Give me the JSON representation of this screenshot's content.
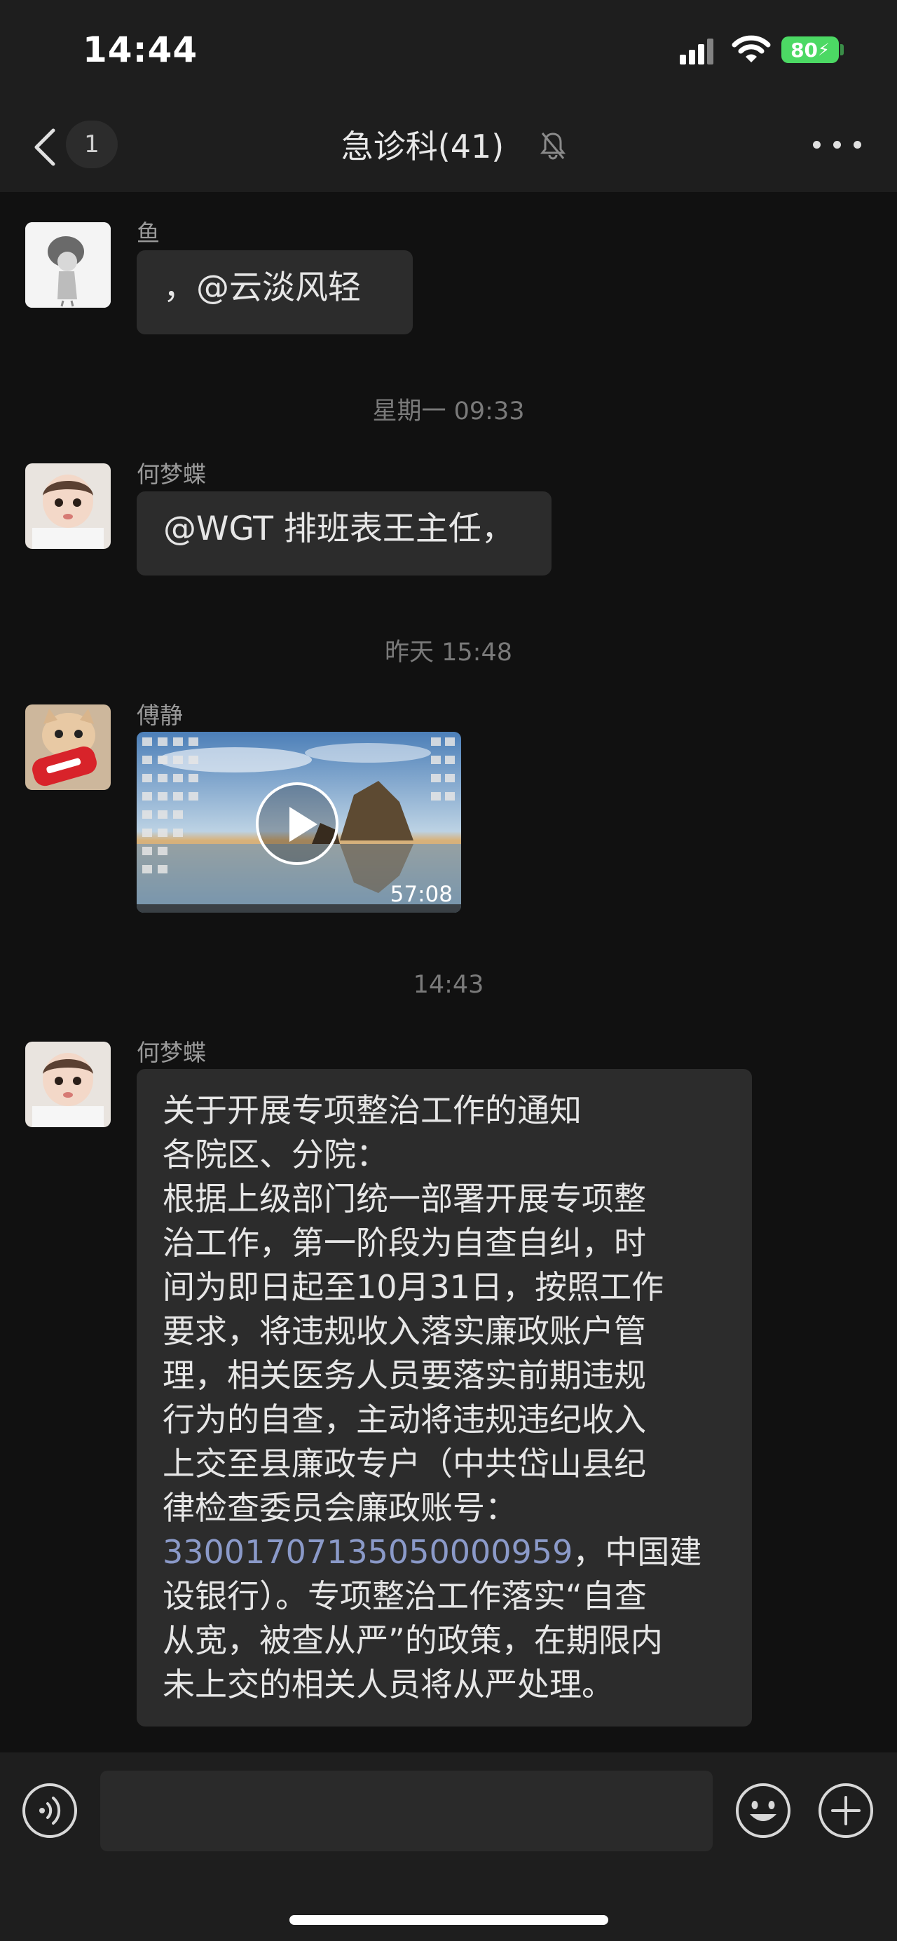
{
  "status_bar": {
    "time": "14:44",
    "battery": "80",
    "signal-icon": "cellular-signal-icon",
    "wifi-icon": "wifi-icon"
  },
  "header": {
    "back_icon": "chevron-left-icon",
    "unread_count": "1",
    "title": "急诊科(41)",
    "mute_icon": "bell-slash-icon",
    "more_icon": "ellipsis-icon"
  },
  "messages": [
    {
      "sender": "鱼",
      "text": "，@云淡风轻"
    },
    {
      "sender": "何梦蝶",
      "text": "@WGT 排班表王主任，"
    },
    {
      "sender": "傅静",
      "video_duration": "57:08"
    },
    {
      "sender": "何梦蝶",
      "lines": [
        "关于开展专项整治工作的通知",
        "各院区、分院：",
        "根据上级部门统一部署开展专项整",
        "治工作，第一阶段为自查自纠，时",
        "间为即日起至10月31日，按照工作",
        "要求，将违规收入落实廉政账户管",
        "理，相关医务人员要落实前期违规",
        "行为的自查，主动将违规违纪收入",
        "上交至县廉政专户（中共岱山县纪",
        "律检查委员会廉政账号：",
        "设银行）。专项整治工作落实“自查",
        "从宽，被查从严”的政策，在期限内",
        "未上交的相关人员将从严处理。"
      ],
      "account_link": "33001707135050000959",
      "account_suffix": "，中国建"
    }
  ],
  "timestamps": [
    "星期一 09:33",
    "昨天 15:48",
    "14:43"
  ],
  "input_bar": {
    "voice_icon": "voice-icon",
    "emoji_icon": "emoji-icon",
    "plus_icon": "plus-icon"
  }
}
